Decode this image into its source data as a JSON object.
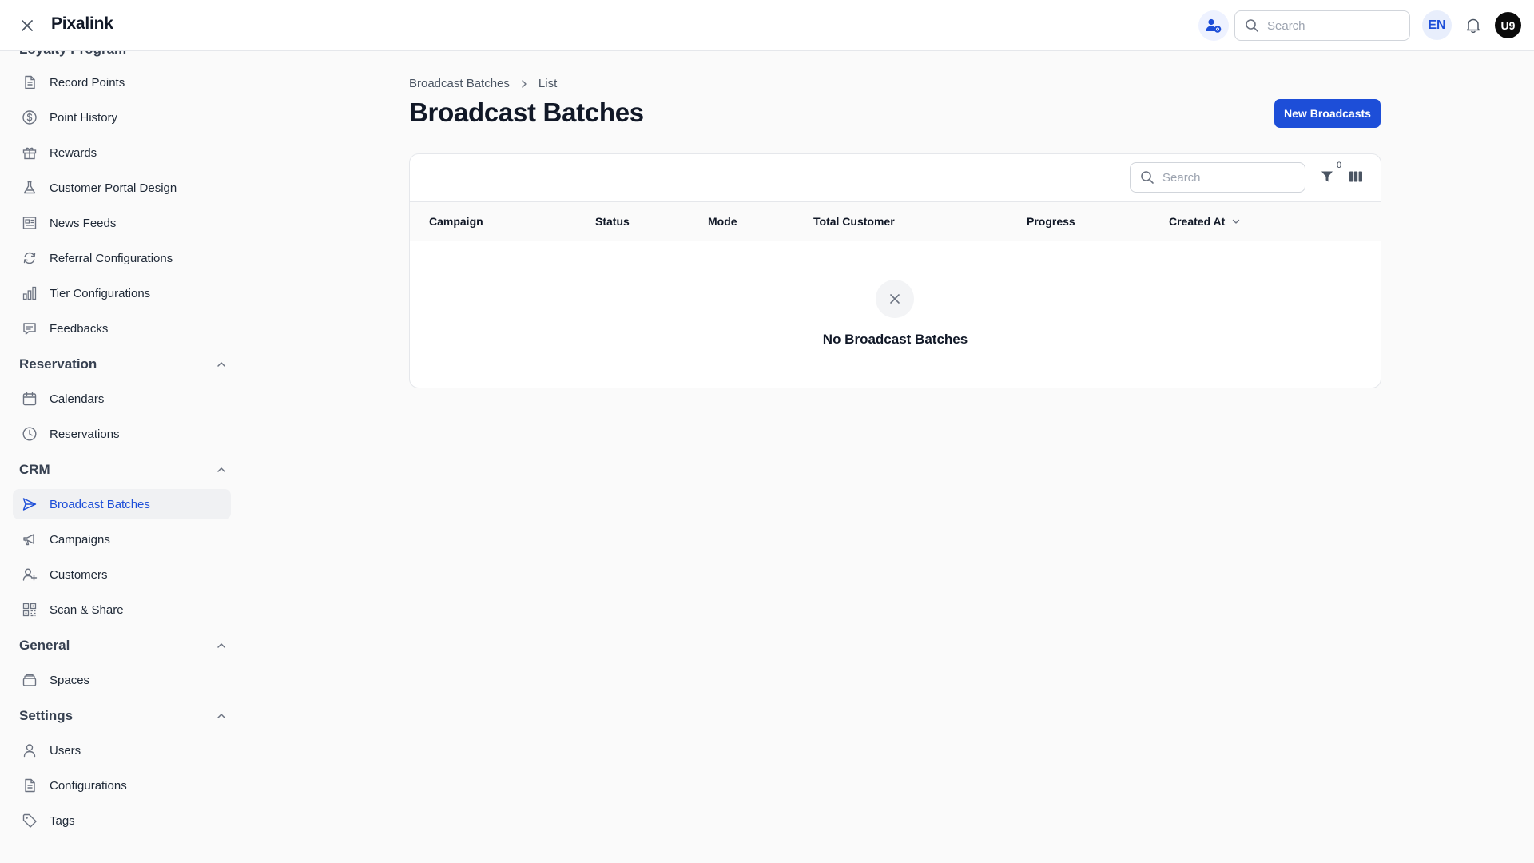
{
  "header": {
    "brand": "Pixalink",
    "search_placeholder": "Search",
    "language": "EN",
    "avatar_initials": "U9"
  },
  "sidebar": {
    "partial_section_title": "Loyalty Program",
    "loyalty_items": [
      {
        "label": "Record Points",
        "icon": "document-icon"
      },
      {
        "label": "Point History",
        "icon": "dollar-circle-icon"
      },
      {
        "label": "Rewards",
        "icon": "gift-icon"
      },
      {
        "label": "Customer Portal Design",
        "icon": "flask-icon"
      },
      {
        "label": "News Feeds",
        "icon": "newspaper-icon"
      },
      {
        "label": "Referral Configurations",
        "icon": "refresh-icon"
      },
      {
        "label": "Tier Configurations",
        "icon": "bar-chart-icon"
      },
      {
        "label": "Feedbacks",
        "icon": "chat-icon"
      }
    ],
    "reservation": {
      "title": "Reservation",
      "items": [
        {
          "label": "Calendars",
          "icon": "calendar-icon"
        },
        {
          "label": "Reservations",
          "icon": "clock-icon"
        }
      ]
    },
    "crm": {
      "title": "CRM",
      "items": [
        {
          "label": "Broadcast Batches",
          "icon": "send-icon",
          "active": true
        },
        {
          "label": "Campaigns",
          "icon": "megaphone-icon"
        },
        {
          "label": "Customers",
          "icon": "user-plus-icon"
        },
        {
          "label": "Scan & Share",
          "icon": "qr-code-icon"
        }
      ]
    },
    "general": {
      "title": "General",
      "items": [
        {
          "label": "Spaces",
          "icon": "stack-icon"
        }
      ]
    },
    "settings": {
      "title": "Settings",
      "items": [
        {
          "label": "Users",
          "icon": "user-icon"
        },
        {
          "label": "Configurations",
          "icon": "document-icon"
        },
        {
          "label": "Tags",
          "icon": "tag-icon"
        }
      ]
    }
  },
  "main": {
    "breadcrumb": [
      "Broadcast Batches",
      "List"
    ],
    "title": "Broadcast Batches",
    "new_button": "New Broadcasts",
    "table": {
      "search_placeholder": "Search",
      "filter_count": "0",
      "columns": [
        "Campaign",
        "Status",
        "Mode",
        "Total Customer",
        "Progress",
        "Created At"
      ],
      "sorted_column": "Created At",
      "empty_text": "No Broadcast Batches"
    }
  },
  "colors": {
    "accent": "#1d4ed8",
    "active_bg": "#f0f1f3",
    "page_bg": "#fafafa"
  }
}
